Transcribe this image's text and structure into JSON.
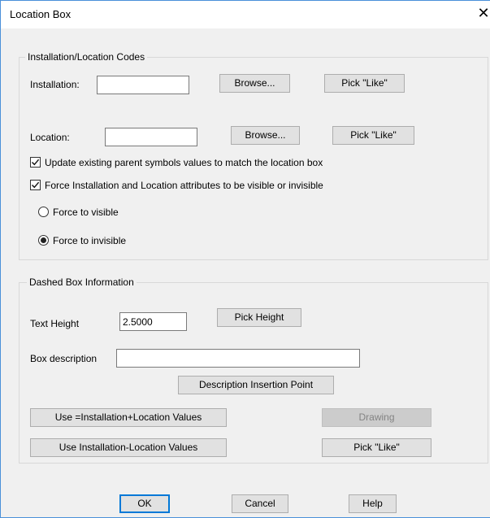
{
  "window": {
    "title": "Location Box",
    "close_symbol": "✕"
  },
  "codes_group": {
    "label": "Installation/Location Codes",
    "installation_label": "Installation:",
    "installation_value": "",
    "installation_browse": "Browse...",
    "installation_pick_like": "Pick \"Like\"",
    "location_label": "Location:",
    "location_value": "",
    "location_browse": "Browse...",
    "location_pick_like": "Pick \"Like\"",
    "update_parent_label": "Update existing parent symbols values to match the location box",
    "update_parent_checked": true,
    "force_visibility_label": "Force Installation and Location attributes to be visible or invisible",
    "force_visibility_checked": true,
    "force_visible_label": "Force to visible",
    "force_invisible_label": "Force to invisible",
    "selected_radio": "force_invisible"
  },
  "dashed_group": {
    "label": "Dashed Box Information",
    "text_height_label": "Text Height",
    "text_height_value": "2.5000",
    "pick_height": "Pick Height",
    "box_description_label": "Box description",
    "box_description_value": "",
    "description_insertion_point": "Description Insertion Point",
    "use_plus_values": "Use =Installation+Location Values",
    "drawing": "Drawing",
    "drawing_disabled": true,
    "use_dash_values": "Use Installation-Location Values",
    "pick_like": "Pick \"Like\""
  },
  "footer": {
    "ok": "OK",
    "cancel": "Cancel",
    "help": "Help"
  },
  "colors": {
    "accent": "#0078d7",
    "window_border": "#4a90d9",
    "dialog_bg": "#f0f0f0"
  },
  "icons": {
    "checkbox": "check-icon",
    "close": "close-icon"
  }
}
